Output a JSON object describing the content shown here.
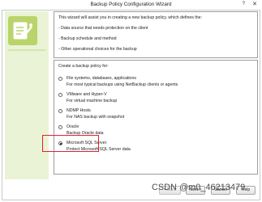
{
  "window": {
    "title": "Backup Policy Configuration Wizard",
    "help_label": "?",
    "close_label": "✕"
  },
  "intro": {
    "lines": [
      "This wizard will assist you in creating a new backup policy, which defines the:",
      "- Data source that needs protection on the client",
      "- Backup schedule and method",
      "- Other operational choices for the backup"
    ]
  },
  "policy_types": {
    "heading": "Create a backup policy for:",
    "options": [
      {
        "label": "File systems, databases, applications",
        "desc": "For most typical backups using NetBackup clients or agents",
        "selected": false
      },
      {
        "label": "VMware and Hyper-V",
        "desc": "For virtual machine backup",
        "selected": false
      },
      {
        "label": "NDMP Hosts",
        "desc": "For NAS backup with snapshot",
        "selected": false
      },
      {
        "label": "Oracle",
        "desc": "Backup Oracle data",
        "selected": false
      },
      {
        "label": "Microsoft SQL Server",
        "desc": "Protect Microsoft SQL Server data",
        "selected": true
      }
    ]
  },
  "buttons": {
    "back": "< Back",
    "next": "Next >",
    "cancel": "Cancel",
    "help": "Help"
  },
  "watermark": "CSDN @m0_46213479",
  "colors": {
    "accent_red": "#e0232e",
    "logo_green": "#b9d46a"
  }
}
